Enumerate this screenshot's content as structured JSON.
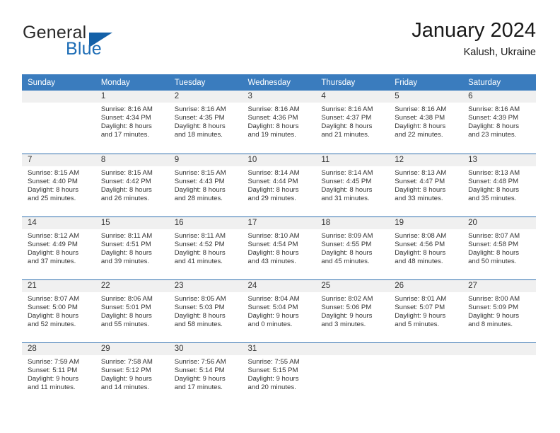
{
  "brand": {
    "name_part1": "General",
    "name_part2": "Blue",
    "accent_color": "#1461a8"
  },
  "header": {
    "title": "January 2024",
    "location": "Kalush, Ukraine"
  },
  "theme": {
    "header_row_bg": "#3a7cbe",
    "daynum_bg": "#f0f0f0",
    "row_divider": "#2f6fae",
    "text": "#333333"
  },
  "weekday_headers": [
    "Sunday",
    "Monday",
    "Tuesday",
    "Wednesday",
    "Thursday",
    "Friday",
    "Saturday"
  ],
  "weeks": [
    [
      {
        "day": "",
        "sunrise": "",
        "sunset": "",
        "daylight_line1": "",
        "daylight_line2": "",
        "blank": true
      },
      {
        "day": "1",
        "sunrise": "Sunrise: 8:16 AM",
        "sunset": "Sunset: 4:34 PM",
        "daylight_line1": "Daylight: 8 hours",
        "daylight_line2": "and 17 minutes."
      },
      {
        "day": "2",
        "sunrise": "Sunrise: 8:16 AM",
        "sunset": "Sunset: 4:35 PM",
        "daylight_line1": "Daylight: 8 hours",
        "daylight_line2": "and 18 minutes."
      },
      {
        "day": "3",
        "sunrise": "Sunrise: 8:16 AM",
        "sunset": "Sunset: 4:36 PM",
        "daylight_line1": "Daylight: 8 hours",
        "daylight_line2": "and 19 minutes."
      },
      {
        "day": "4",
        "sunrise": "Sunrise: 8:16 AM",
        "sunset": "Sunset: 4:37 PM",
        "daylight_line1": "Daylight: 8 hours",
        "daylight_line2": "and 21 minutes."
      },
      {
        "day": "5",
        "sunrise": "Sunrise: 8:16 AM",
        "sunset": "Sunset: 4:38 PM",
        "daylight_line1": "Daylight: 8 hours",
        "daylight_line2": "and 22 minutes."
      },
      {
        "day": "6",
        "sunrise": "Sunrise: 8:16 AM",
        "sunset": "Sunset: 4:39 PM",
        "daylight_line1": "Daylight: 8 hours",
        "daylight_line2": "and 23 minutes."
      }
    ],
    [
      {
        "day": "7",
        "sunrise": "Sunrise: 8:15 AM",
        "sunset": "Sunset: 4:40 PM",
        "daylight_line1": "Daylight: 8 hours",
        "daylight_line2": "and 25 minutes."
      },
      {
        "day": "8",
        "sunrise": "Sunrise: 8:15 AM",
        "sunset": "Sunset: 4:42 PM",
        "daylight_line1": "Daylight: 8 hours",
        "daylight_line2": "and 26 minutes."
      },
      {
        "day": "9",
        "sunrise": "Sunrise: 8:15 AM",
        "sunset": "Sunset: 4:43 PM",
        "daylight_line1": "Daylight: 8 hours",
        "daylight_line2": "and 28 minutes."
      },
      {
        "day": "10",
        "sunrise": "Sunrise: 8:14 AM",
        "sunset": "Sunset: 4:44 PM",
        "daylight_line1": "Daylight: 8 hours",
        "daylight_line2": "and 29 minutes."
      },
      {
        "day": "11",
        "sunrise": "Sunrise: 8:14 AM",
        "sunset": "Sunset: 4:45 PM",
        "daylight_line1": "Daylight: 8 hours",
        "daylight_line2": "and 31 minutes."
      },
      {
        "day": "12",
        "sunrise": "Sunrise: 8:13 AM",
        "sunset": "Sunset: 4:47 PM",
        "daylight_line1": "Daylight: 8 hours",
        "daylight_line2": "and 33 minutes."
      },
      {
        "day": "13",
        "sunrise": "Sunrise: 8:13 AM",
        "sunset": "Sunset: 4:48 PM",
        "daylight_line1": "Daylight: 8 hours",
        "daylight_line2": "and 35 minutes."
      }
    ],
    [
      {
        "day": "14",
        "sunrise": "Sunrise: 8:12 AM",
        "sunset": "Sunset: 4:49 PM",
        "daylight_line1": "Daylight: 8 hours",
        "daylight_line2": "and 37 minutes."
      },
      {
        "day": "15",
        "sunrise": "Sunrise: 8:11 AM",
        "sunset": "Sunset: 4:51 PM",
        "daylight_line1": "Daylight: 8 hours",
        "daylight_line2": "and 39 minutes."
      },
      {
        "day": "16",
        "sunrise": "Sunrise: 8:11 AM",
        "sunset": "Sunset: 4:52 PM",
        "daylight_line1": "Daylight: 8 hours",
        "daylight_line2": "and 41 minutes."
      },
      {
        "day": "17",
        "sunrise": "Sunrise: 8:10 AM",
        "sunset": "Sunset: 4:54 PM",
        "daylight_line1": "Daylight: 8 hours",
        "daylight_line2": "and 43 minutes."
      },
      {
        "day": "18",
        "sunrise": "Sunrise: 8:09 AM",
        "sunset": "Sunset: 4:55 PM",
        "daylight_line1": "Daylight: 8 hours",
        "daylight_line2": "and 45 minutes."
      },
      {
        "day": "19",
        "sunrise": "Sunrise: 8:08 AM",
        "sunset": "Sunset: 4:56 PM",
        "daylight_line1": "Daylight: 8 hours",
        "daylight_line2": "and 48 minutes."
      },
      {
        "day": "20",
        "sunrise": "Sunrise: 8:07 AM",
        "sunset": "Sunset: 4:58 PM",
        "daylight_line1": "Daylight: 8 hours",
        "daylight_line2": "and 50 minutes."
      }
    ],
    [
      {
        "day": "21",
        "sunrise": "Sunrise: 8:07 AM",
        "sunset": "Sunset: 5:00 PM",
        "daylight_line1": "Daylight: 8 hours",
        "daylight_line2": "and 52 minutes."
      },
      {
        "day": "22",
        "sunrise": "Sunrise: 8:06 AM",
        "sunset": "Sunset: 5:01 PM",
        "daylight_line1": "Daylight: 8 hours",
        "daylight_line2": "and 55 minutes."
      },
      {
        "day": "23",
        "sunrise": "Sunrise: 8:05 AM",
        "sunset": "Sunset: 5:03 PM",
        "daylight_line1": "Daylight: 8 hours",
        "daylight_line2": "and 58 minutes."
      },
      {
        "day": "24",
        "sunrise": "Sunrise: 8:04 AM",
        "sunset": "Sunset: 5:04 PM",
        "daylight_line1": "Daylight: 9 hours",
        "daylight_line2": "and 0 minutes."
      },
      {
        "day": "25",
        "sunrise": "Sunrise: 8:02 AM",
        "sunset": "Sunset: 5:06 PM",
        "daylight_line1": "Daylight: 9 hours",
        "daylight_line2": "and 3 minutes."
      },
      {
        "day": "26",
        "sunrise": "Sunrise: 8:01 AM",
        "sunset": "Sunset: 5:07 PM",
        "daylight_line1": "Daylight: 9 hours",
        "daylight_line2": "and 5 minutes."
      },
      {
        "day": "27",
        "sunrise": "Sunrise: 8:00 AM",
        "sunset": "Sunset: 5:09 PM",
        "daylight_line1": "Daylight: 9 hours",
        "daylight_line2": "and 8 minutes."
      }
    ],
    [
      {
        "day": "28",
        "sunrise": "Sunrise: 7:59 AM",
        "sunset": "Sunset: 5:11 PM",
        "daylight_line1": "Daylight: 9 hours",
        "daylight_line2": "and 11 minutes."
      },
      {
        "day": "29",
        "sunrise": "Sunrise: 7:58 AM",
        "sunset": "Sunset: 5:12 PM",
        "daylight_line1": "Daylight: 9 hours",
        "daylight_line2": "and 14 minutes."
      },
      {
        "day": "30",
        "sunrise": "Sunrise: 7:56 AM",
        "sunset": "Sunset: 5:14 PM",
        "daylight_line1": "Daylight: 9 hours",
        "daylight_line2": "and 17 minutes."
      },
      {
        "day": "31",
        "sunrise": "Sunrise: 7:55 AM",
        "sunset": "Sunset: 5:15 PM",
        "daylight_line1": "Daylight: 9 hours",
        "daylight_line2": "and 20 minutes."
      },
      {
        "day": "",
        "sunrise": "",
        "sunset": "",
        "daylight_line1": "",
        "daylight_line2": "",
        "blank": true
      },
      {
        "day": "",
        "sunrise": "",
        "sunset": "",
        "daylight_line1": "",
        "daylight_line2": "",
        "blank": true
      },
      {
        "day": "",
        "sunrise": "",
        "sunset": "",
        "daylight_line1": "",
        "daylight_line2": "",
        "blank": true
      }
    ]
  ]
}
